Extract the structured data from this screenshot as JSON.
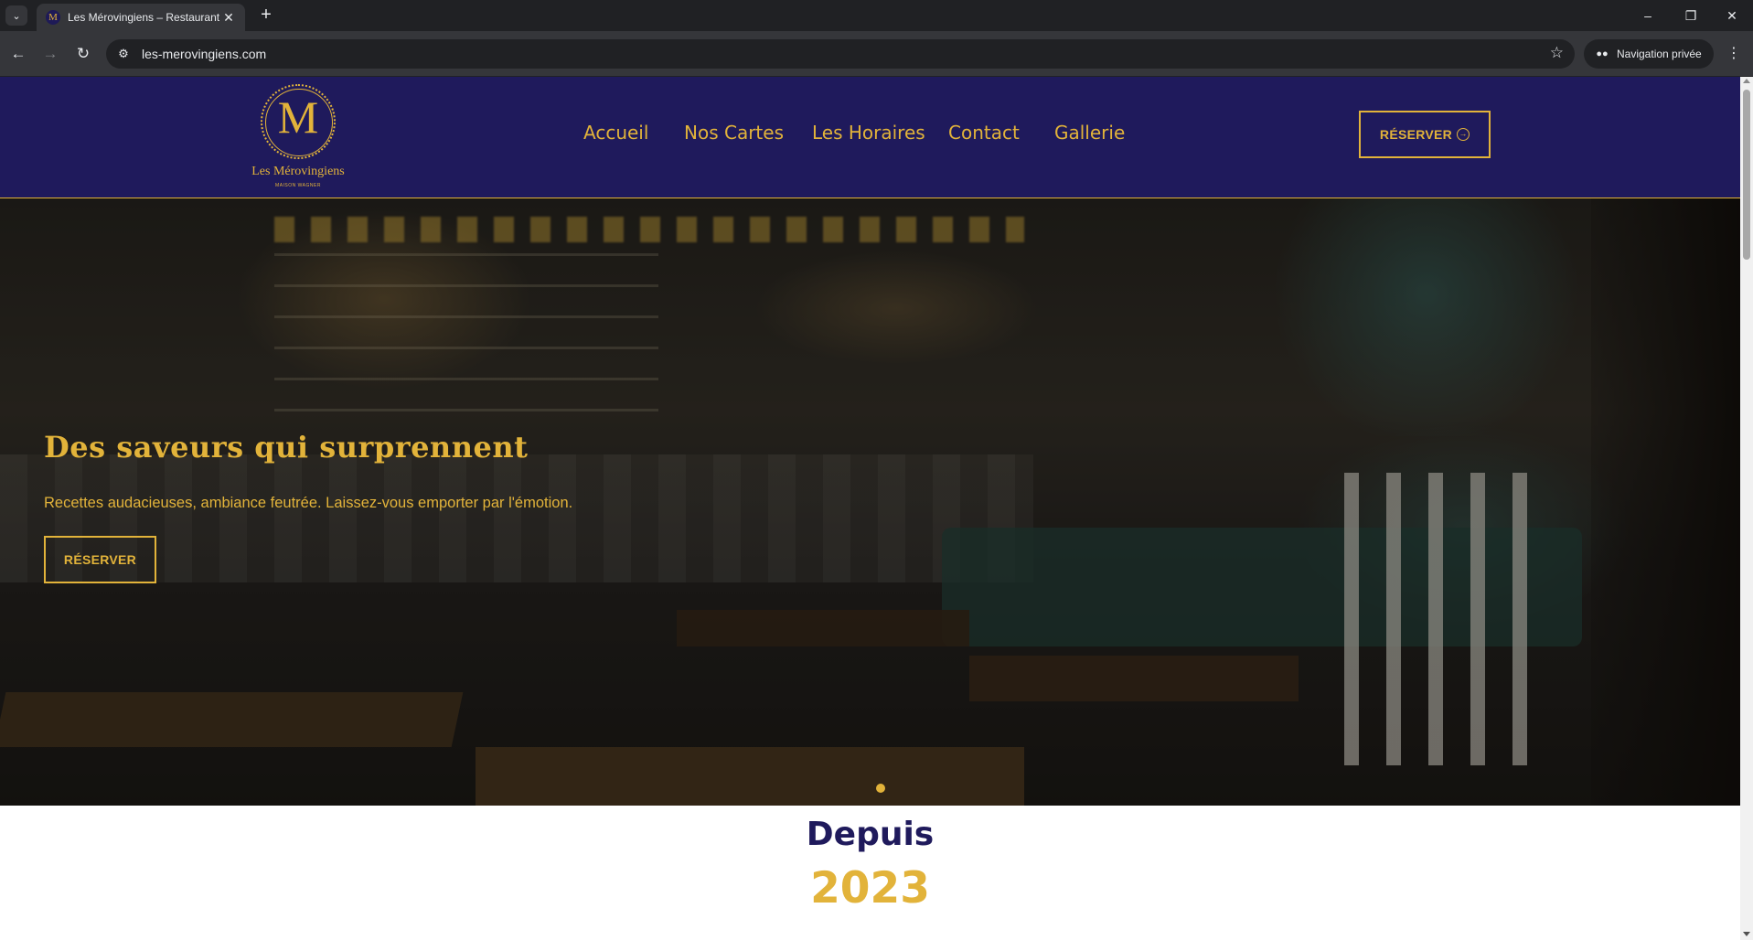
{
  "browser": {
    "tab_title": "Les Mérovingiens – Restaurant",
    "favicon_letter": "M",
    "url": "les-merovingiens.com",
    "incognito_label": "Navigation privée"
  },
  "colors": {
    "brand_navy": "#1f1a5c",
    "brand_gold": "#e2b33a"
  },
  "header": {
    "logo": {
      "letter": "M",
      "name": "Les Mérovingiens",
      "subtitle": "MAISON WAGNER"
    },
    "nav": [
      {
        "label": "Accueil"
      },
      {
        "label": "Nos Cartes"
      },
      {
        "label": "Les Horaires"
      },
      {
        "label": "Contact"
      },
      {
        "label": "Gallerie"
      }
    ],
    "cta_label": "RÉSERVER"
  },
  "hero": {
    "title": "Des saveurs qui surprennent",
    "subtitle": "Recettes audacieuses, ambiance feutrée. Laissez-vous emporter par l'émotion.",
    "cta_label": "RÉSERVER",
    "slide_count": 1,
    "active_slide": 1
  },
  "since": {
    "label": "Depuis",
    "year": "2023"
  }
}
